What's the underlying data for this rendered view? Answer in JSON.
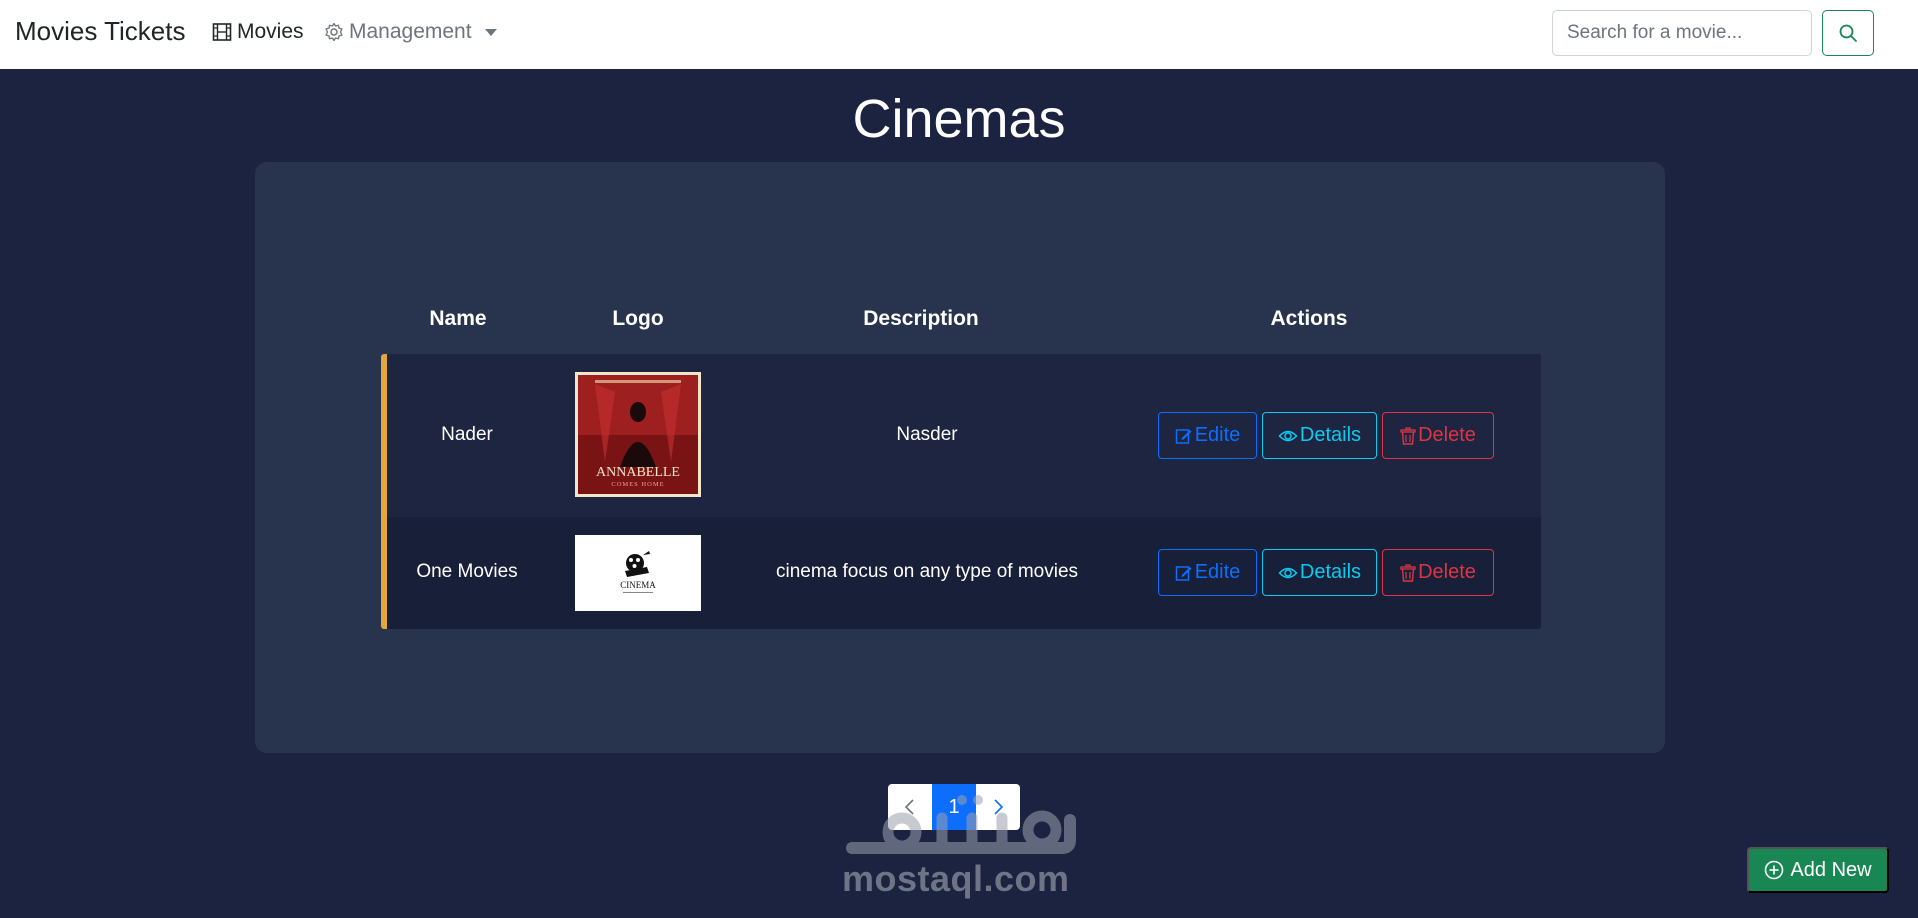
{
  "navbar": {
    "brand": "Movies Tickets",
    "movies_label": "Movies",
    "management_label": "Management",
    "search_placeholder": "Search for a movie..."
  },
  "page": {
    "title": "Cinemas"
  },
  "table": {
    "headers": [
      "Name",
      "Logo",
      "Description",
      "Actions"
    ],
    "rows": [
      {
        "name": "Nader",
        "description": "Nasder",
        "logo": {
          "kind": "movie-poster",
          "title_text": "ANNABELLE",
          "subtitle_text": "COMES HOME"
        }
      },
      {
        "name": "One Movies",
        "description": "cinema focus on any type of movies",
        "logo": {
          "kind": "cinema-logo",
          "title_text": "CINEMA"
        }
      }
    ],
    "actions": {
      "edit": "Edite",
      "details": "Details",
      "delete": "Delete"
    }
  },
  "pagination": {
    "current_page": "1"
  },
  "add_button": {
    "label": "Add New"
  },
  "watermark": {
    "latin": "mostaql.com"
  },
  "colors": {
    "background": "#1c2340",
    "panel": "#28334d",
    "row_accent": "#e2a83c",
    "edit": "#0d6efd",
    "details": "#0dcaf0",
    "delete": "#dc3545",
    "add": "#198754"
  }
}
